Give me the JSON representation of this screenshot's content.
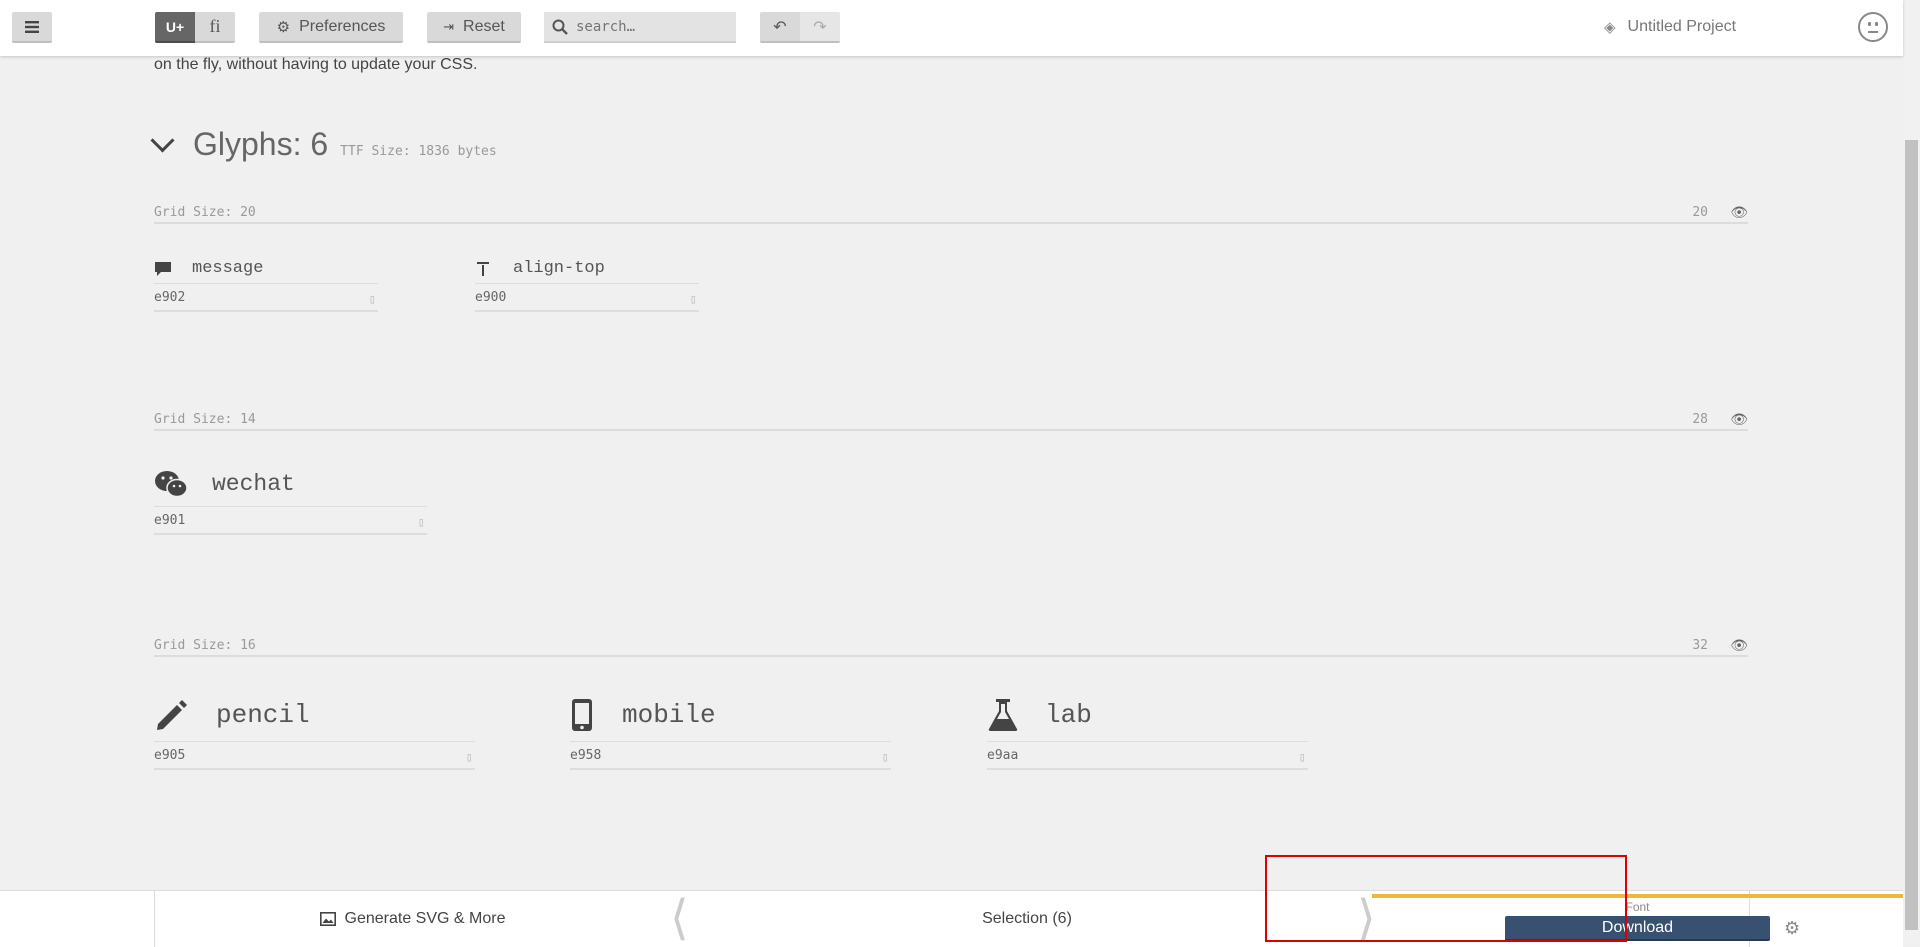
{
  "toolbar": {
    "unicode_label": "U+",
    "ligature_label": "fi",
    "preferences_label": "Preferences",
    "reset_label": "Reset",
    "search_placeholder": "search…",
    "project_name": "Untitled Project"
  },
  "intro_text": "on the fly, without having to update your CSS.",
  "glyphs_header": {
    "title": "Glyphs: 6",
    "ttf_size": "TTF Size: 1836 bytes"
  },
  "sets": [
    {
      "grid_label": "Grid Size: 20",
      "size": "20",
      "glyphs": [
        {
          "name": "message",
          "code": "e902"
        },
        {
          "name": "align-top",
          "code": "e900"
        }
      ]
    },
    {
      "grid_label": "Grid Size: 14",
      "size": "28",
      "glyphs": [
        {
          "name": "wechat",
          "code": "e901"
        }
      ]
    },
    {
      "grid_label": "Grid Size: 16",
      "size": "32",
      "glyphs": [
        {
          "name": "pencil",
          "code": "e905"
        },
        {
          "name": "mobile",
          "code": "e958"
        },
        {
          "name": "lab",
          "code": "e9aa"
        }
      ]
    }
  ],
  "bottom": {
    "generate_label": "Generate SVG & More",
    "selection_label": "Selection (6)",
    "font_label": "Font",
    "download_label": "Download"
  },
  "colors": {
    "accent": "#f2b63d",
    "download_bg": "#395170"
  }
}
